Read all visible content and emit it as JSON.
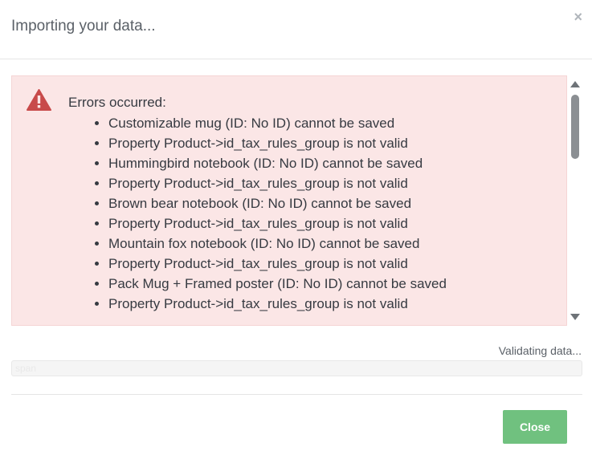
{
  "modal": {
    "title": "Importing your data...",
    "close_glyph": "×"
  },
  "errors": {
    "icon": "warning-icon",
    "icon_color": "#c84a4a",
    "background": "#fbe6e6",
    "title": "Errors occurred:",
    "items": [
      "Customizable mug (ID: No ID) cannot be saved",
      "Property Product->id_tax_rules_group is not valid",
      "Hummingbird notebook (ID: No ID) cannot be saved",
      "Property Product->id_tax_rules_group is not valid",
      "Brown bear notebook (ID: No ID) cannot be saved",
      "Property Product->id_tax_rules_group is not valid",
      "Mountain fox notebook (ID: No ID) cannot be saved",
      "Property Product->id_tax_rules_group is not valid",
      "Pack Mug + Framed poster (ID: No ID) cannot be saved",
      "Property Product->id_tax_rules_group is not valid"
    ]
  },
  "progress": {
    "status": "Validating data...",
    "label": "span",
    "value_percent": 0
  },
  "footer": {
    "close_label": "Close",
    "close_color": "#70c17f"
  }
}
